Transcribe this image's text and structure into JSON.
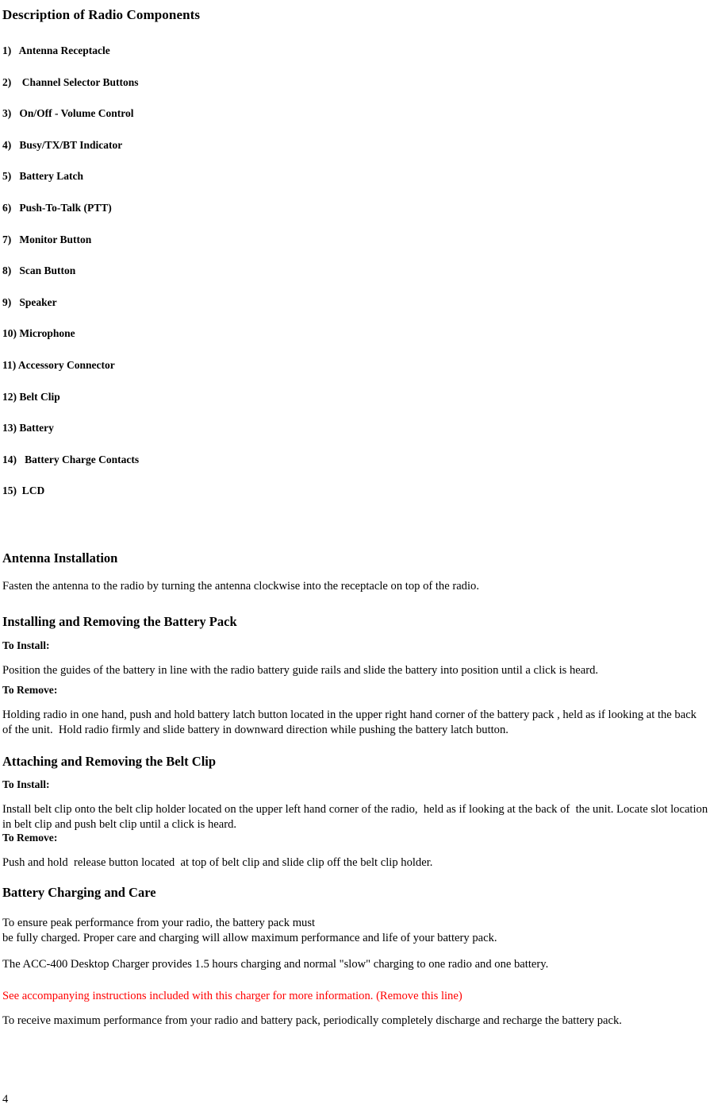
{
  "document": {
    "title": "Description of Radio Components",
    "page_number": "4"
  },
  "components": {
    "items": [
      {
        "number": "1)",
        "label": "Antenna Receptacle",
        "indent": "   "
      },
      {
        "number": "2)",
        "label": "Channel Selector Buttons",
        "indent": "    "
      },
      {
        "number": "3)",
        "label": "On/Off - Volume Control",
        "indent": "   "
      },
      {
        "number": "4)",
        "label": "Busy/TX/BT Indicator",
        "indent": "   "
      },
      {
        "number": "5)",
        "label": "Battery Latch",
        "indent": "   "
      },
      {
        "number": "6)",
        "label": "Push-To-Talk (PTT)",
        "indent": "   "
      },
      {
        "number": "7)",
        "label": "Monitor Button",
        "indent": "   "
      },
      {
        "number": "8)",
        "label": "Scan Button",
        "indent": "   "
      },
      {
        "number": "9)",
        "label": "Speaker",
        "indent": "   "
      },
      {
        "number": "10)",
        "label": "Microphone",
        "indent": " "
      },
      {
        "number": "11)",
        "label": "Accessory Connector",
        "indent": " "
      },
      {
        "number": "12)",
        "label": "Belt Clip",
        "indent": " "
      },
      {
        "number": "13)",
        "label": "Battery",
        "indent": " "
      },
      {
        "number": "14)",
        "label": "Battery Charge Contacts",
        "indent": "   "
      },
      {
        "number": "15)",
        "label": "LCD",
        "indent": "  "
      }
    ]
  },
  "sections": {
    "antenna": {
      "heading": "Antenna Installation",
      "body": "Fasten the antenna to the radio by turning the antenna clockwise into the receptacle on top of the radio."
    },
    "battery_pack": {
      "heading": "Installing and Removing the Battery Pack",
      "install_label": "To Install:",
      "install_body": "Position the guides of the battery in line with the radio battery guide rails and slide the battery into position until a click is heard.",
      "remove_label": "To Remove:",
      "remove_body": "Holding radio in one hand, push and hold battery latch button located in the upper right hand corner of the battery pack , held as if looking at the back of the unit.  Hold radio firmly and slide battery in downward direction while pushing the battery latch button."
    },
    "belt_clip": {
      "heading": "Attaching and Removing the Belt Clip",
      "install_label": "To Install:",
      "install_body": "Install belt clip onto the belt clip holder located on the upper left hand corner of the radio,  held as if looking at the back of  the unit. Locate slot location in belt clip and push belt clip until a click is heard.",
      "remove_label": "To Remove:",
      "remove_body": "Push and hold  release button located  at top of belt clip and slide clip off the belt clip holder."
    },
    "battery_charging": {
      "heading": "Battery Charging and Care",
      "para1": "To ensure peak performance from your radio, the battery pack must\nbe fully charged. Proper care and charging will allow maximum performance and life of your battery pack.",
      "para2": "The ACC-400 Desktop Charger provides 1.5 hours charging and normal \"slow\" charging to one radio and one battery.",
      "para3_red": "See accompanying instructions included with this charger for more information. (Remove this line)",
      "para4": "To receive maximum performance from your radio and battery pack, periodically completely discharge and recharge the battery pack."
    }
  },
  "colors": {
    "text": "#000000",
    "note_red": "#ff0000",
    "background": "#ffffff"
  }
}
